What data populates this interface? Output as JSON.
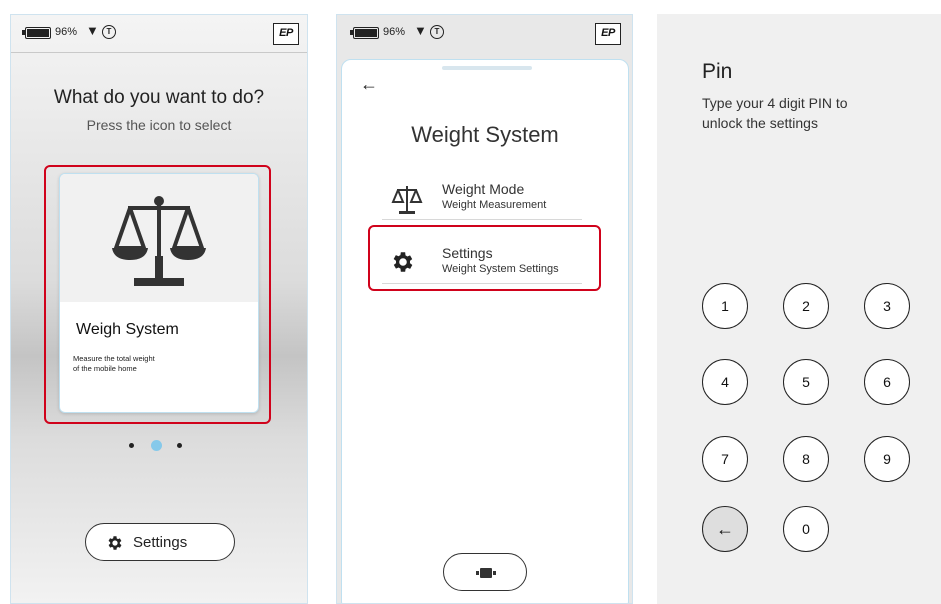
{
  "status": {
    "battery_pct": "96%",
    "wifi_icon": "wifi-icon",
    "logo_text": "EP"
  },
  "screen1": {
    "title": "What do you want to do?",
    "subtitle": "Press the icon to select",
    "card": {
      "title": "Weigh System",
      "desc_line1": "Measure the total weight",
      "desc_line2": "of the mobile home",
      "icon": "scale-icon"
    },
    "pagination": {
      "count": 3,
      "active_index": 1
    },
    "settings_button": "Settings"
  },
  "screen2": {
    "back_icon": "back-arrow-icon",
    "title": "Weight System",
    "menu": [
      {
        "title": "Weight Mode",
        "subtitle": "Weight Measurement",
        "icon": "scale-icon"
      },
      {
        "title": "Settings",
        "subtitle": "Weight System Settings",
        "icon": "gear-icon"
      }
    ]
  },
  "screen3": {
    "title": "Pin",
    "desc_line1": "Type your 4 digit PIN to",
    "desc_line2": "unlock the settings",
    "keys": [
      "1",
      "2",
      "3",
      "4",
      "5",
      "6",
      "7",
      "8",
      "9",
      "←",
      "0"
    ]
  },
  "colors": {
    "highlight": "#d0021b",
    "accent_dot": "#86c9ea",
    "card_border": "#bfe0f0"
  }
}
